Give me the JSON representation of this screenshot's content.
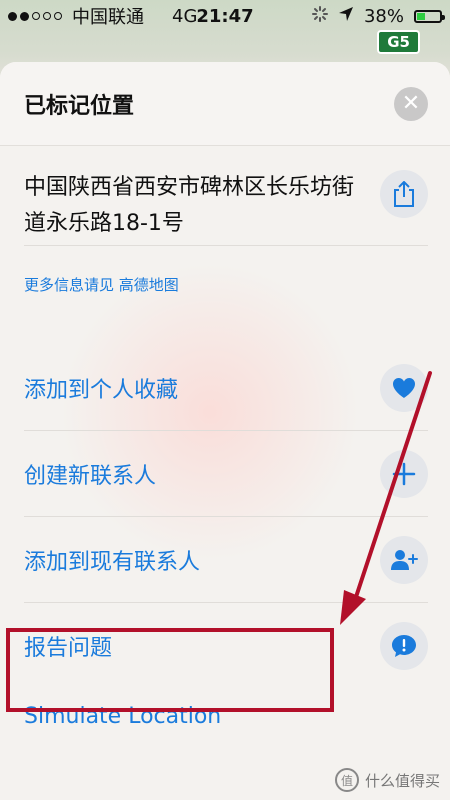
{
  "status_bar": {
    "carrier": "中国联通",
    "network": "4G",
    "time": "21:47",
    "battery_percent": "38%",
    "battery_level": 0.38
  },
  "map": {
    "road_badge": "G5"
  },
  "sheet": {
    "title": "已标记位置",
    "address": "中国陕西省西安市碑林区长乐坊街道永乐路18-1号",
    "info_link": "更多信息请见 高德地图",
    "actions": [
      {
        "label": "添加到个人收藏",
        "icon": "heart-icon"
      },
      {
        "label": "创建新联系人",
        "icon": "plus-icon"
      },
      {
        "label": "添加到现有联系人",
        "icon": "add-contact-icon"
      },
      {
        "label": "报告问题",
        "icon": "report-issue-icon"
      }
    ],
    "simulate_label": "Simulate Location"
  },
  "watermark": {
    "text": "什么值得买",
    "logo": "值"
  },
  "colors": {
    "accent": "#1a7bdc",
    "annotation": "#b2102a",
    "icon_bg": "#e4e6ea"
  }
}
